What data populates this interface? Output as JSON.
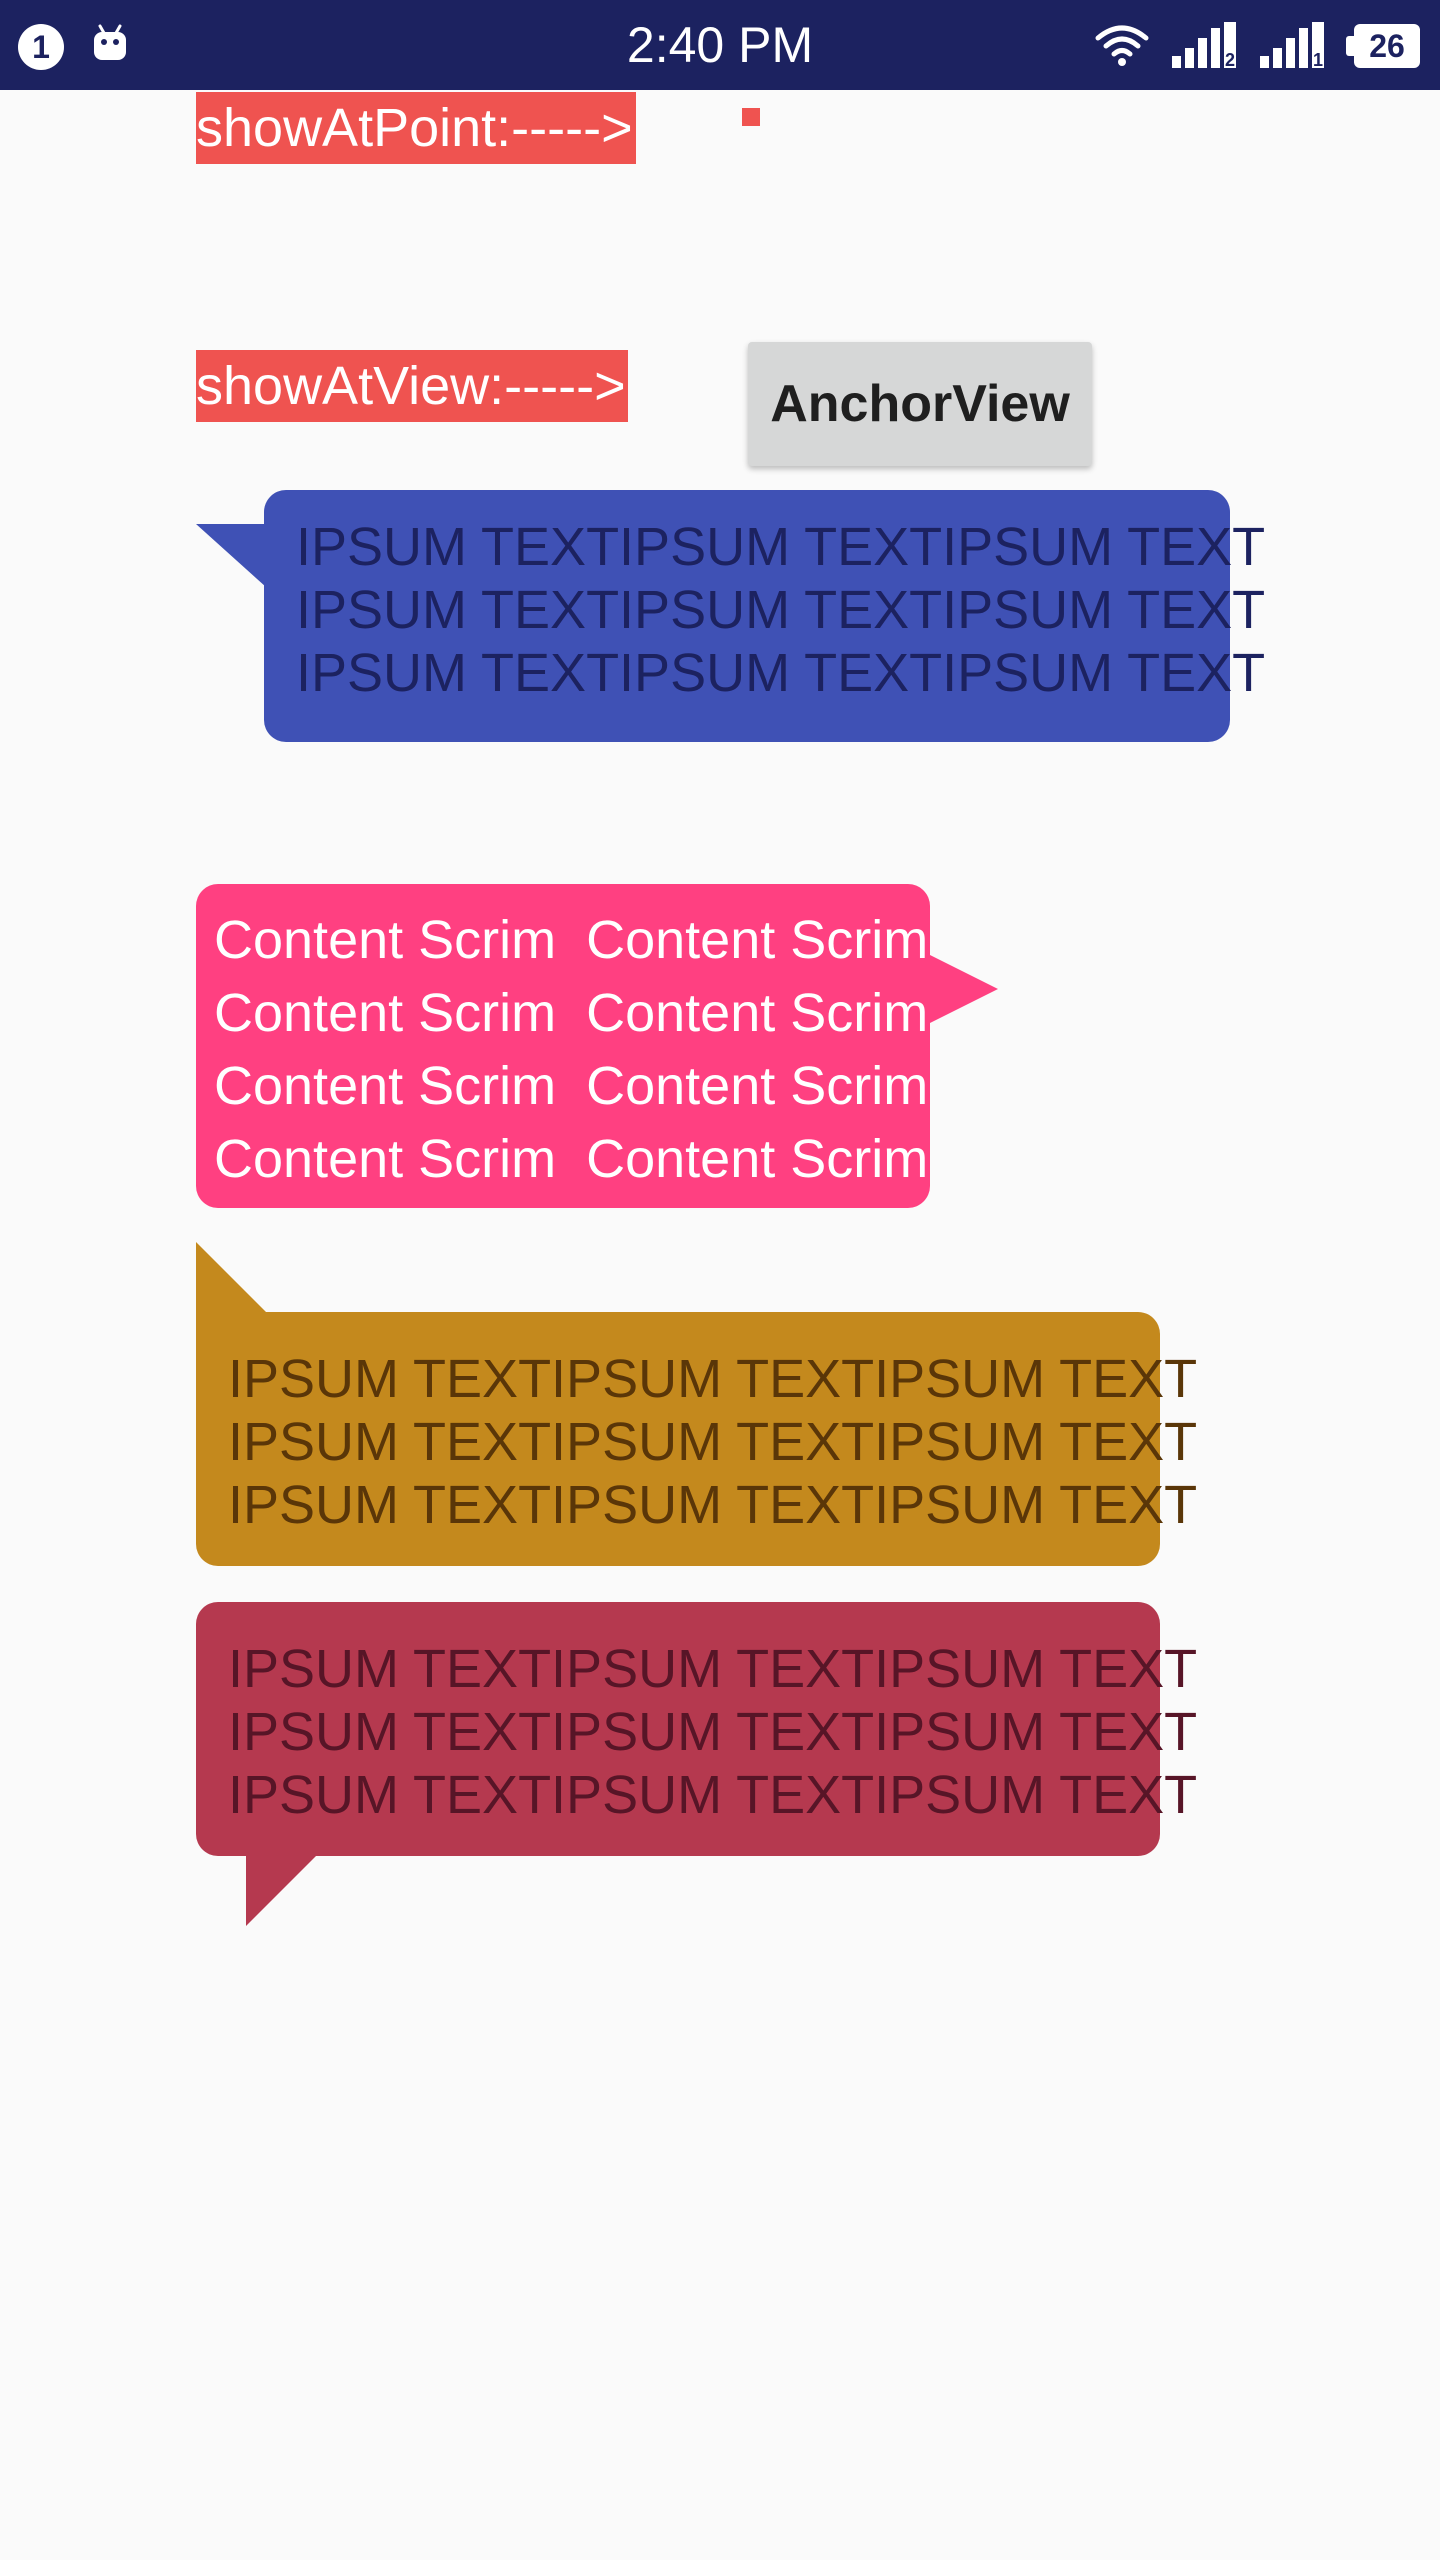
{
  "status_bar": {
    "notification_count": "1",
    "time": "2:40 PM",
    "battery_level": "26",
    "background_color": "#1C2260",
    "icons": [
      "notification-badge-icon",
      "android-debug-icon",
      "wifi-icon",
      "signal-icon",
      "signal-icon",
      "battery-icon"
    ]
  },
  "labels": {
    "show_at_point": "showAtPoint:----->",
    "show_at_view": "showAtView:----->"
  },
  "anchor_button": {
    "label": "AnchorView"
  },
  "bubbles": {
    "blue": {
      "color": "#3F51B5",
      "lines": [
        "IPSUM TEXTIPSUM TEXTIPSUM TEXT",
        "IPSUM TEXTIPSUM TEXTIPSUM TEXT",
        "IPSUM TEXTIPSUM TEXTIPSUM TEXT"
      ]
    },
    "pink": {
      "color": "#FF4081",
      "lines": [
        "Content Scrim  Content Scrim",
        "Content Scrim  Content Scrim",
        "Content Scrim  Content Scrim",
        "Content Scrim  Content Scrim"
      ]
    },
    "gold": {
      "color": "#C4891D",
      "lines": [
        "IPSUM TEXTIPSUM TEXTIPSUM TEXT",
        "IPSUM TEXTIPSUM TEXTIPSUM TEXT",
        "IPSUM TEXTIPSUM TEXTIPSUM TEXT"
      ]
    },
    "crimson": {
      "color": "#B5394F",
      "lines": [
        "IPSUM TEXTIPSUM TEXTIPSUM TEXT",
        "IPSUM TEXTIPSUM TEXTIPSUM TEXT",
        "IPSUM TEXTIPSUM TEXTIPSUM TEXT"
      ]
    }
  },
  "colors": {
    "label_background": "#EF5350",
    "page_background": "#FAFAFA",
    "button_background": "#D6D7D7"
  }
}
